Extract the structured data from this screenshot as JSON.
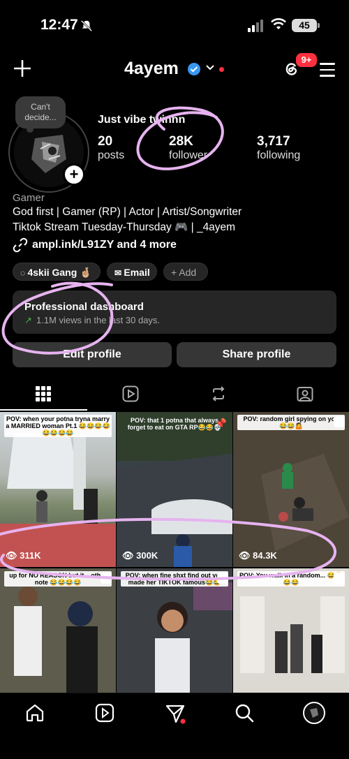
{
  "status": {
    "time": "12:47",
    "battery": "45"
  },
  "header": {
    "username": "4ayem",
    "notifications_badge": "9+"
  },
  "profile": {
    "note": "Can't decide...",
    "display_name": "Just vibe twinnn",
    "stats": [
      {
        "value": "20",
        "label": "posts"
      },
      {
        "value": "28K",
        "label": "follower"
      },
      {
        "value": "3,717",
        "label": "following"
      }
    ],
    "category": "Gamer",
    "bio_lines": [
      "God first | Gamer (RP) | Actor | Artist/Songwriter",
      "Tiktok Stream Tuesday-Thursday 🎮 | _4ayem"
    ],
    "link": "ampl.ink/L91ZY and 4 more"
  },
  "chips": {
    "group": "4skii Gang 🤞🏼",
    "email": "Email",
    "add": "Add"
  },
  "dashboard": {
    "title": "Professional dashboard",
    "subtitle": "1.1M views in the last 30 days."
  },
  "buttons": {
    "edit": "Edit profile",
    "share": "Share profile"
  },
  "posts": [
    {
      "caption": "POV: when your potna tryna marry a MARRIED woman Pt.1 😂😂😂😂😂😂😂😂",
      "views": "311K"
    },
    {
      "caption": "POV: that 1 potna that always forget to eat on GTA RP😂😂💀",
      "views": "300K"
    },
    {
      "caption": "POV: random girl spying on you 😂😂🤷",
      "views": "84.3K"
    },
    {
      "caption": "up for NO REASON but it ...other note 😂😂😂😂",
      "views": ""
    },
    {
      "caption": "POV: when fine shxt find out you made her TIKTOK famous😂😂",
      "views": ""
    },
    {
      "caption": "POV: You walk in a random... 😂😂😂😂",
      "views": ""
    }
  ],
  "colors": {
    "accent": "#ff3040",
    "verified": "#3897f0",
    "scribble": "#e6b3ef"
  }
}
